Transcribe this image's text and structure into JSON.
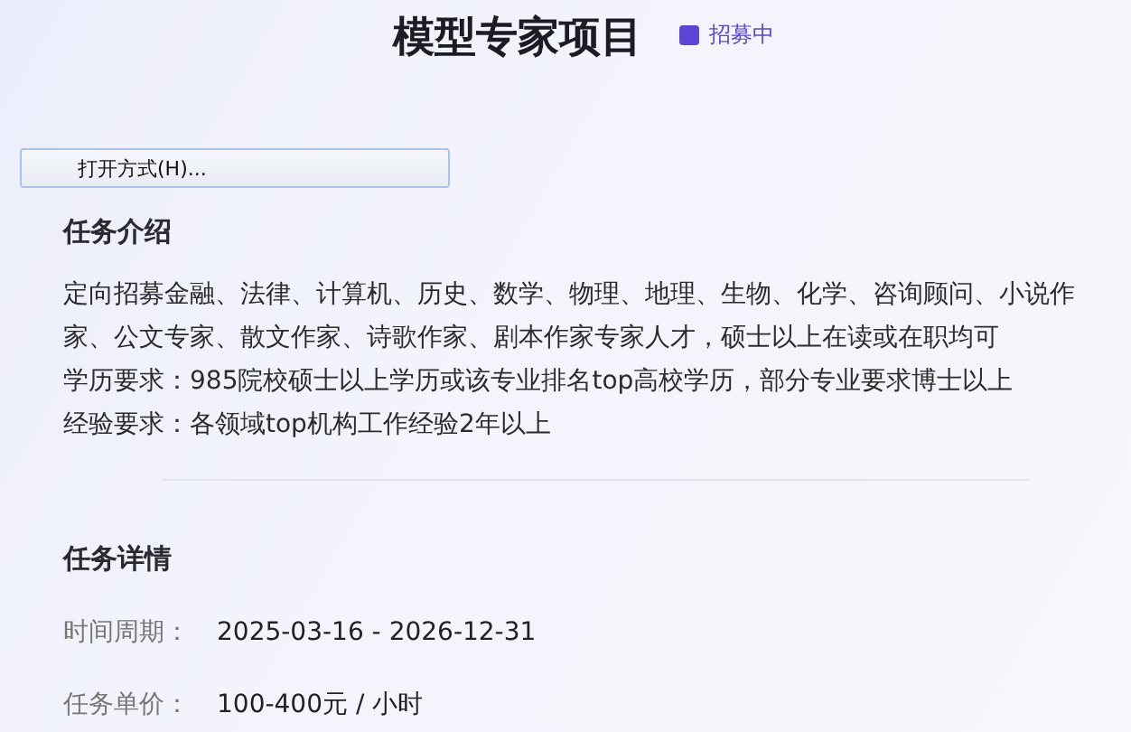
{
  "header": {
    "title": "模型专家项目",
    "status": {
      "label": "招募中",
      "color": "#5b45d6"
    }
  },
  "context_menu": {
    "items": [
      {
        "label": "打开方式(H)..."
      }
    ]
  },
  "intro": {
    "heading": "任务介绍",
    "description": "定向招募金融、法律、计算机、历史、数学、物理、地理、生物、化学、咨询顾问、小说作家、公文专家、散文作家、诗歌作家、剧本作家专家人才，硕士以上在读或在职均可",
    "requirements": [
      "学历要求：985院校硕士以上学历或该专业排名top高校学历，部分专业要求博士以上",
      "经验要求：各领域top机构工作经验2年以上"
    ]
  },
  "details": {
    "heading": "任务详情",
    "rows": [
      {
        "label": "时间周期：",
        "value": "2025-03-16 - 2026-12-31"
      },
      {
        "label": "任务单价：",
        "value": "100-400元 / 小时"
      }
    ]
  }
}
